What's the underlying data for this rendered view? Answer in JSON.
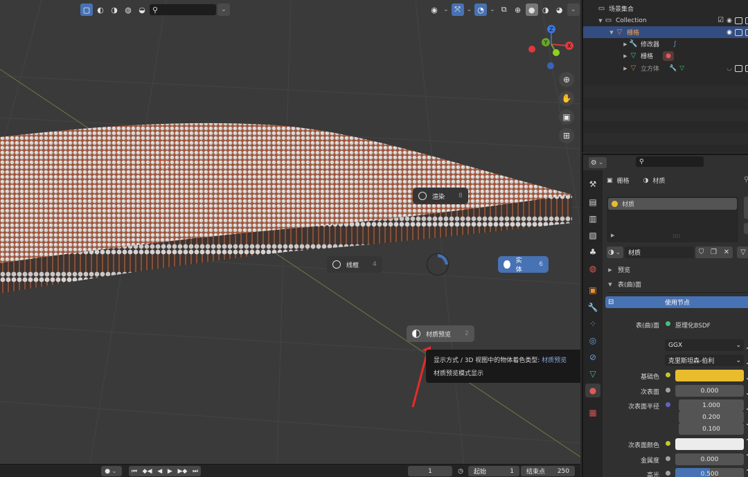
{
  "viewport": {
    "header_search": "",
    "pie_menu": {
      "render": {
        "label": "渲染",
        "key": "8"
      },
      "wireframe": {
        "label": "线框",
        "key": "4"
      },
      "solid": {
        "label": "实体",
        "key": "6"
      },
      "material_preview": {
        "label": "材质预览",
        "key": "2"
      }
    },
    "gizmo_axes": {
      "z": "Z",
      "y": "Y",
      "x": "X"
    },
    "tooltip": {
      "line1_prefix": "显示方式 / 3D 视图中的物体着色类型: ",
      "line1_highlight": "材质预览",
      "line2": "材质预览模式显示"
    }
  },
  "outliner": {
    "rows": [
      {
        "label": "场景集合"
      },
      {
        "label": "Collection"
      },
      {
        "label": "栅格"
      },
      {
        "label": "修改器"
      },
      {
        "label": "栅格"
      },
      {
        "label": "立方体"
      }
    ]
  },
  "properties": {
    "search": "",
    "breadcrumb_object": "栅格",
    "breadcrumb_material": "材质",
    "slot_name": "材质",
    "material_name": "材质",
    "preview_panel": "预览",
    "surface_panel": "表(曲)面",
    "use_nodes_button": "使用节点",
    "surface_label": "表(曲)面",
    "surface_value": "原理化BSDF",
    "distribution": "GGX",
    "subsurface_method": "克里斯坦森-伯利",
    "params": {
      "base_color": {
        "label": "基础色"
      },
      "subsurface": {
        "label": "次表面",
        "value": "0.000"
      },
      "subsurface_radius": {
        "label": "次表面半径",
        "v1": "1.000",
        "v2": "0.200",
        "v3": "0.100"
      },
      "subsurface_color": {
        "label": "次表面颜色"
      },
      "metallic": {
        "label": "金属度",
        "value": "0.000"
      },
      "specular": {
        "label": "高光",
        "value": "0.500",
        "fraction": 0.5
      }
    },
    "colors": {
      "base_color": "#e9bc2e",
      "subsurface_color": "#ececec",
      "accent": "#4772b3"
    }
  },
  "timeline": {
    "current_frame": "1",
    "start_label": "起始",
    "start_value": "1",
    "end_label": "结束点",
    "end_value": "250"
  }
}
